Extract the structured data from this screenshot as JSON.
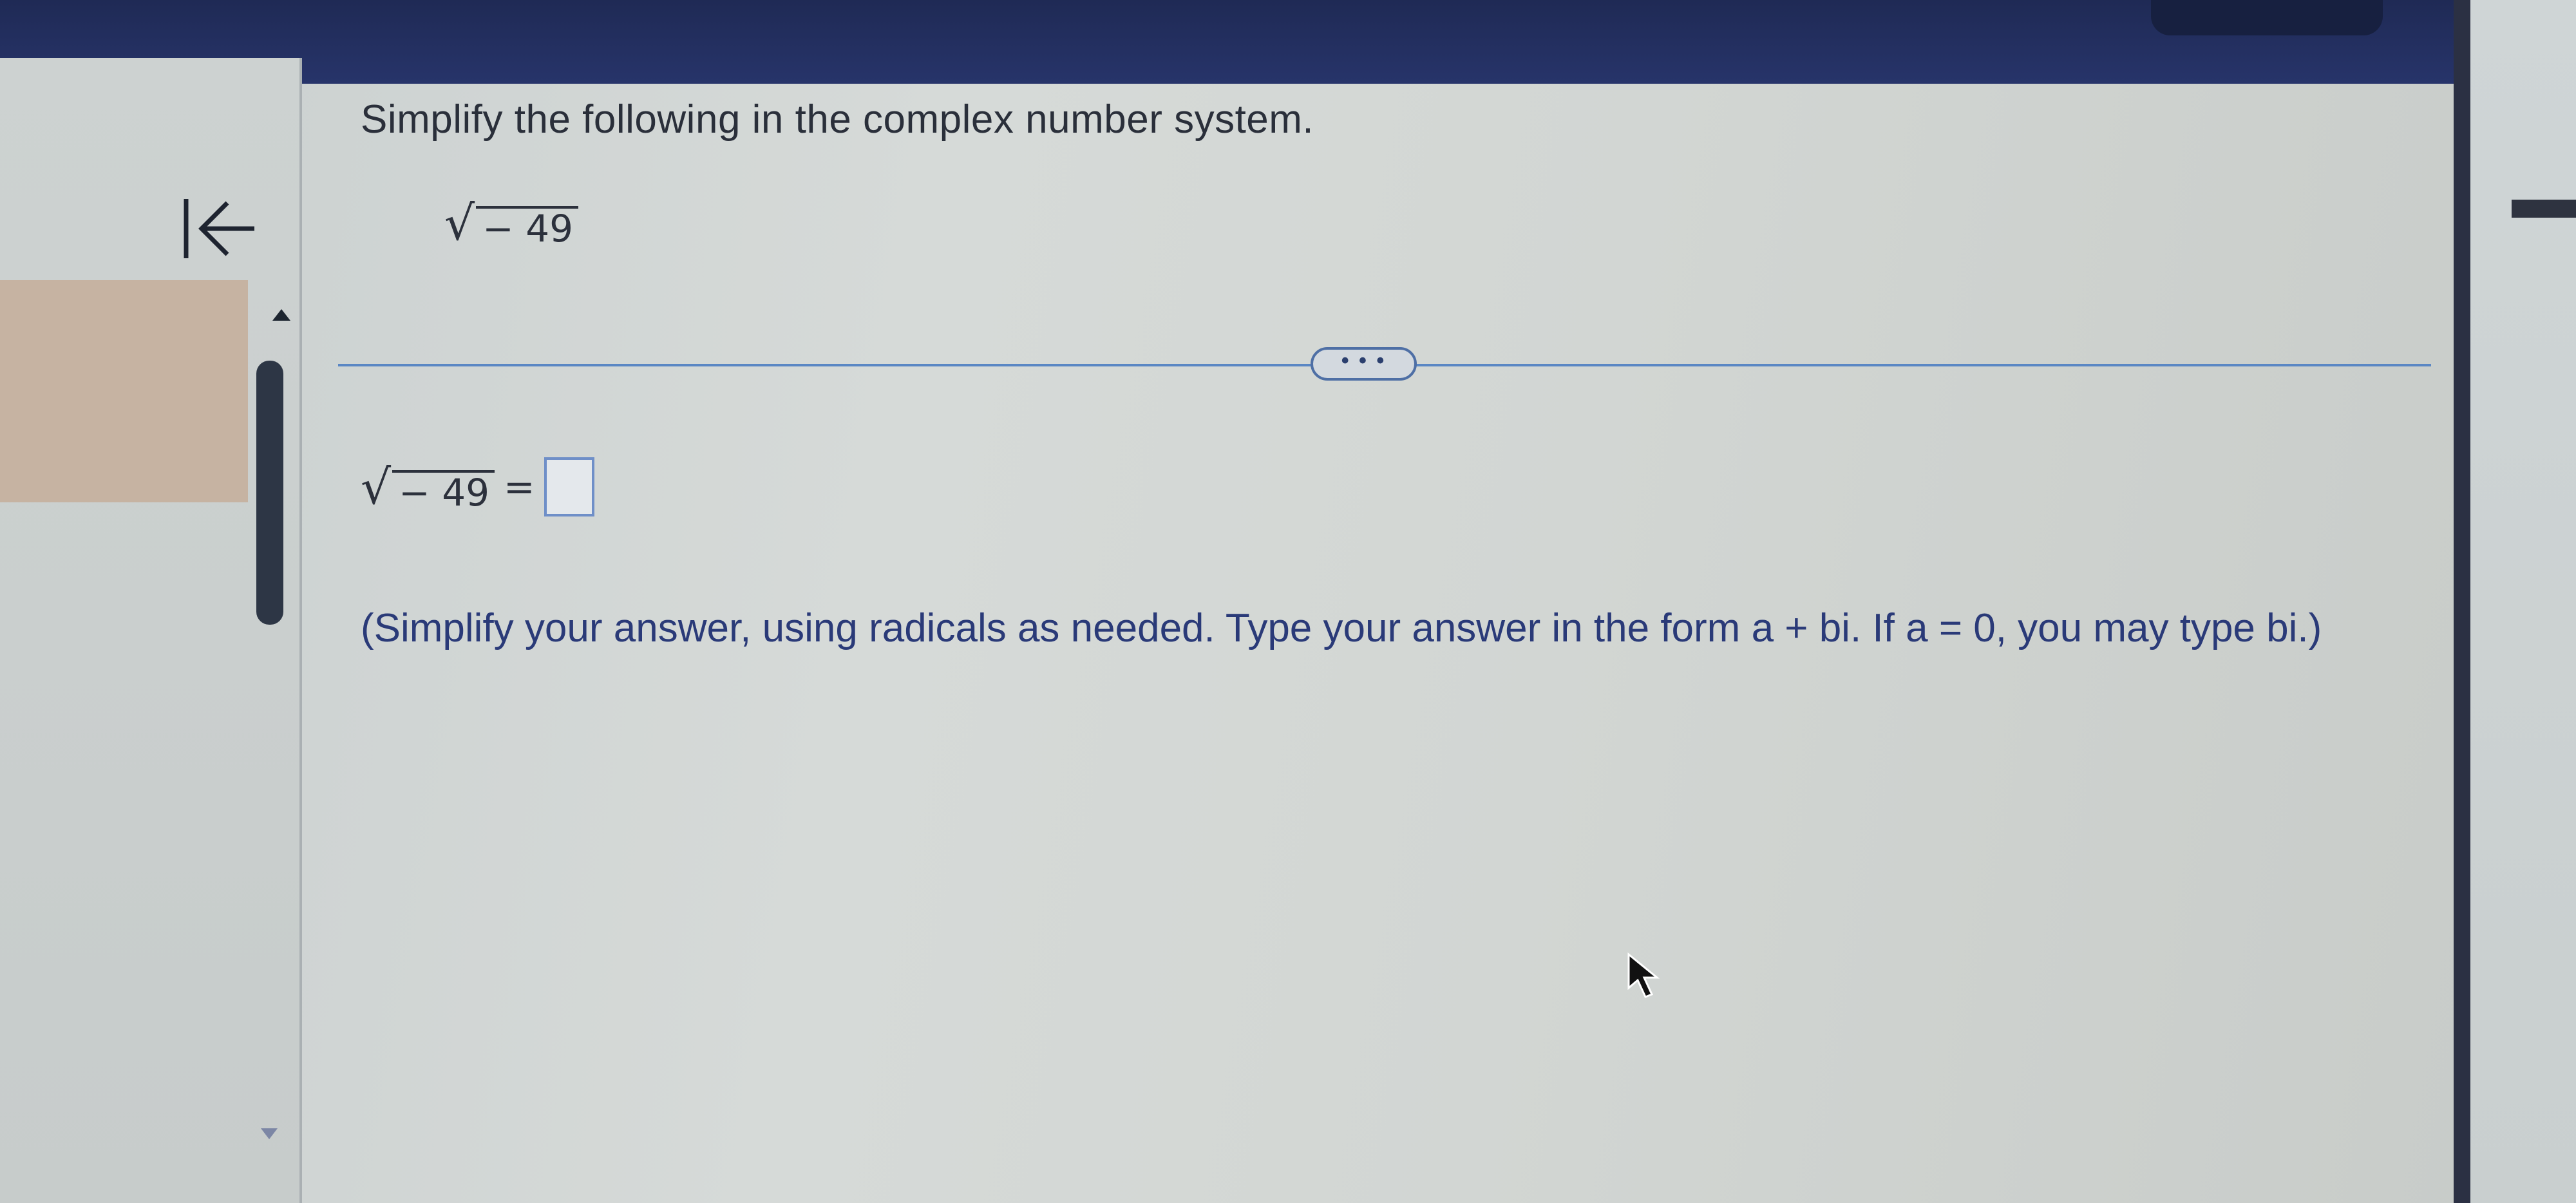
{
  "question": {
    "prompt": "Simplify the following in the complex number system.",
    "radicand": "− 49"
  },
  "more_button": {
    "label": "• • •"
  },
  "answer": {
    "radicand": "− 49",
    "equals": "=",
    "input_value": ""
  },
  "instructions": {
    "part1": "(Simplify your answer, using radicals as needed.  Type your answer in the form ",
    "form": "a + bi",
    "part2": ".  If ",
    "condition": "a = 0",
    "part3": ", you may type ",
    "short_form": "bi",
    "part4": ".)"
  },
  "colors": {
    "top_bar": "#1f2a55",
    "divider": "#5a87c4",
    "instruction_text": "#2a3a78"
  },
  "icons": {
    "back": "arrow-left-to-bar",
    "scroll_up": "triangle-up",
    "scroll_down": "triangle-down",
    "cursor": "mouse-pointer"
  }
}
